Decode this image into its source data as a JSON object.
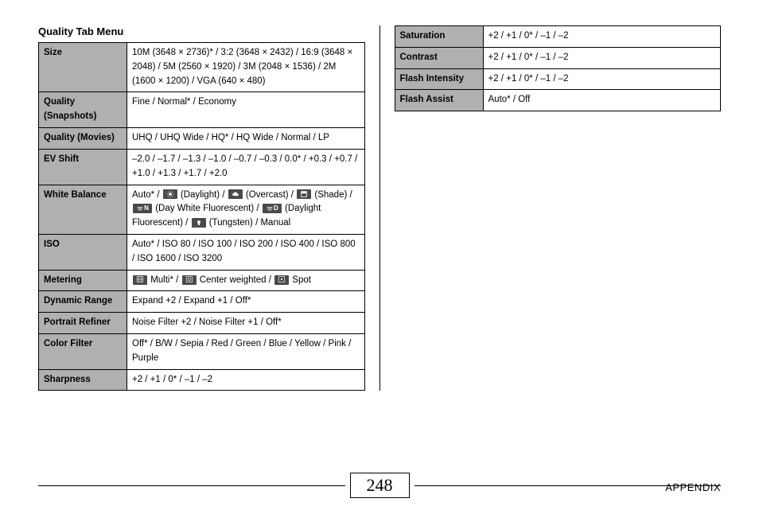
{
  "title": "Quality Tab Menu",
  "left_rows": [
    {
      "label": "Size",
      "value": "10M (3648 × 2736)* / 3:2 (3648 × 2432) / 16:9 (3648 × 2048) / 5M (2560 × 1920) / 3M (2048 × 1536) / 2M (1600 × 1200) / VGA (640 × 480)"
    },
    {
      "label": "Quality (Snapshots)",
      "value": "Fine / Normal* / Economy"
    },
    {
      "label": "Quality (Movies)",
      "value": "UHQ / UHQ Wide / HQ* / HQ Wide / Normal / LP"
    },
    {
      "label": "EV Shift",
      "value": "–2.0 / –1.7 / –1.3 / –1.0 / –0.7 / –0.3 / 0.0* / +0.3 / +0.7 / +1.0 / +1.3 / +1.7 / +2.0"
    },
    {
      "label": "White Balance",
      "value_parts": {
        "pre": "Auto* / ",
        "daylight": " (Daylight) / ",
        "overcast": " (Overcast) / ",
        "shade": " (Shade) / ",
        "dwf_label": "N",
        "dwf": " (Day White Fluorescent) / ",
        "df_label": "D",
        "df": " (Daylight Fluorescent) / ",
        "tungsten": " (Tungsten) / Manual"
      }
    },
    {
      "label": "ISO",
      "value": "Auto* / ISO 80 / ISO 100 / ISO 200 / ISO 400 / ISO 800 / ISO 1600 / ISO 3200"
    },
    {
      "label": "Metering",
      "value_parts": {
        "multi": " Multi* / ",
        "center": " Center weighted / ",
        "spot": " Spot"
      }
    },
    {
      "label": "Dynamic Range",
      "value": "Expand +2 / Expand +1 / Off*"
    },
    {
      "label": "Portrait Refiner",
      "value": "Noise Filter +2 / Noise Filter +1 / Off*"
    },
    {
      "label": "Color Filter",
      "value": "Off* / B/W / Sepia / Red / Green / Blue / Yellow / Pink / Purple"
    },
    {
      "label": "Sharpness",
      "value": "+2 / +1 / 0* / –1 / –2"
    }
  ],
  "right_rows": [
    {
      "label": "Saturation",
      "value": "+2 / +1 / 0* / –1 / –2"
    },
    {
      "label": "Contrast",
      "value": "+2 / +1 / 0* / –1 / –2"
    },
    {
      "label": "Flash Intensity",
      "value": "+2 / +1 / 0* / –1 / –2"
    },
    {
      "label": "Flash Assist",
      "value": "Auto* / Off"
    }
  ],
  "page_number": "248",
  "appendix": "APPENDIX"
}
